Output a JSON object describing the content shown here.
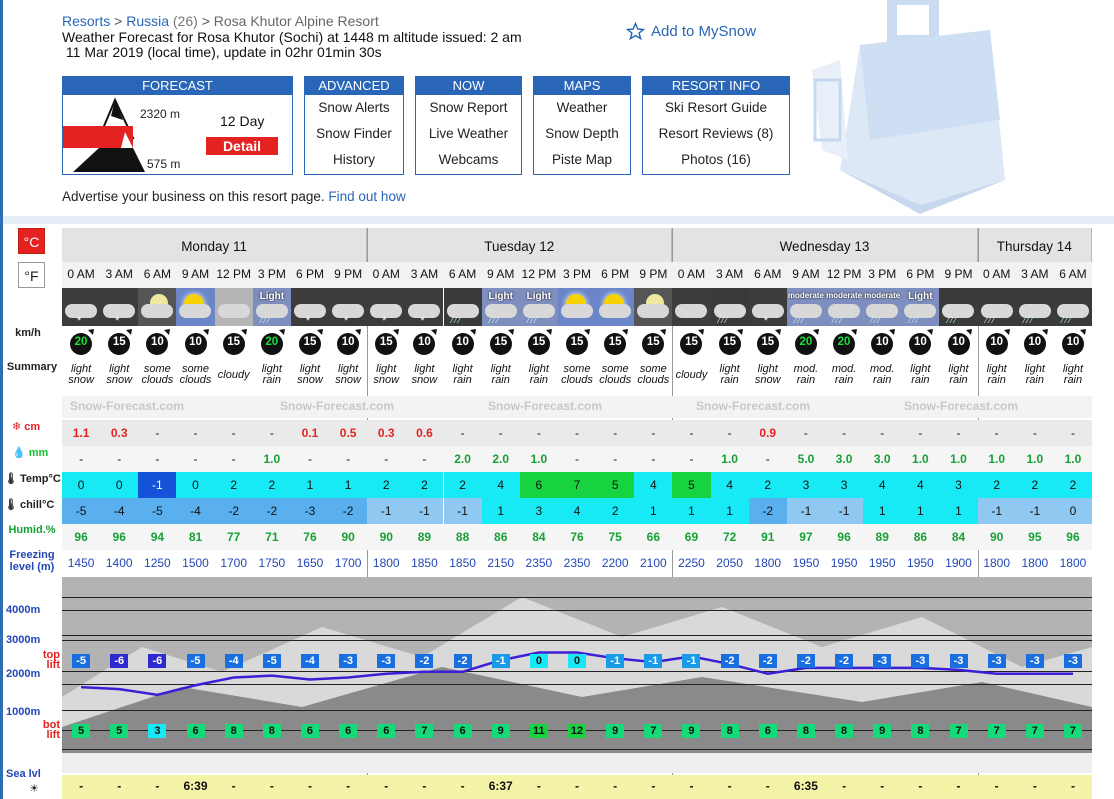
{
  "breadcrumb": {
    "resorts": "Resorts",
    "sep1": ">",
    "russia": "Russia",
    "russia_count": "(26)",
    "sep2": ">",
    "resort": "Rosa Khutor Alpine Resort"
  },
  "heading": {
    "line1": "Weather Forecast for Rosa Khutor (Sochi) at 1448 m altitude issued: 2 am",
    "line2": " 11 Mar 2019 (local time), update in 02hr 01min 30s"
  },
  "mysnow": "Add to MySnow",
  "nav": {
    "forecast": {
      "title": "FORECAST",
      "top": "2320 m",
      "mid": "1448 m",
      "bot": "575 m",
      "days": "12 Day",
      "detail": "Detail"
    },
    "advanced": {
      "title": "ADVANCED",
      "items": [
        "Snow Alerts",
        "Snow Finder",
        "History"
      ]
    },
    "now": {
      "title": "NOW",
      "items": [
        "Snow Report",
        "Live Weather",
        "Webcams"
      ]
    },
    "maps": {
      "title": "MAPS",
      "items": [
        "Weather",
        "Snow Depth",
        "Piste Map"
      ]
    },
    "resort_info": {
      "title": "RESORT INFO",
      "items": [
        "Ski Resort Guide",
        "Resort Reviews (8)",
        "Photos (16)"
      ]
    }
  },
  "advertise": {
    "text": "Advertise your business on this resort page.",
    "link": "Find out how"
  },
  "units": {
    "c": "°C",
    "f": "°F"
  },
  "row_labels": {
    "wind": "km/h",
    "summary": "Summary",
    "snow": "cm",
    "rain": "mm",
    "temp": "Temp°C",
    "chill": "chill°C",
    "humid": "Humid.%",
    "freezing": "Freezing level (m)",
    "top": "top lift",
    "bot": "bot lift",
    "sea": "Sea lvl",
    "l4000": "4000m",
    "l3000": "3000m",
    "l2000": "2000m",
    "l1000": "1000m"
  },
  "days": [
    {
      "name": "Monday 11",
      "cols": 8
    },
    {
      "name": "Tuesday 12",
      "cols": 8
    },
    {
      "name": "Wednesday 13",
      "cols": 8
    },
    {
      "name": "Thursday 14",
      "cols": 3
    }
  ],
  "watermark": "Snow-Forecast.com",
  "colors": {
    "blue": "#2966b8",
    "red": "#e32221",
    "cyan": "#17e8f5",
    "green": "#12d53d"
  },
  "cols": [
    {
      "h": "0 AM",
      "sky": "snow-night",
      "label": "",
      "wind": "20",
      "wc": "green",
      "s1": "light",
      "s2": "snow",
      "snow": "1.1",
      "rain": "-",
      "temp": "0",
      "chill": "-5",
      "hum": "96",
      "frz": "1450",
      "top": "-5",
      "bot": "5"
    },
    {
      "h": "3 AM",
      "sky": "snow-night",
      "label": "",
      "wind": "15",
      "wc": "black",
      "s1": "light",
      "s2": "snow",
      "snow": "0.3",
      "rain": "-",
      "temp": "0",
      "chill": "-4",
      "hum": "96",
      "frz": "1400",
      "top": "-6",
      "bot": "5"
    },
    {
      "h": "6 AM",
      "sky": "moon-cloud",
      "label": "",
      "wind": "10",
      "wc": "black",
      "s1": "some",
      "s2": "clouds",
      "snow": "-",
      "rain": "-",
      "temp": "-1",
      "chill": "-5",
      "hum": "94",
      "frz": "1250",
      "top": "-6",
      "bot": "3"
    },
    {
      "h": "9 AM",
      "sky": "sun-cloud",
      "label": "",
      "wind": "10",
      "wc": "black",
      "s1": "some",
      "s2": "clouds",
      "snow": "-",
      "rain": "-",
      "temp": "0",
      "chill": "-4",
      "hum": "81",
      "frz": "1500",
      "top": "-5",
      "bot": "6"
    },
    {
      "h": "12 PM",
      "sky": "cloudy",
      "label": "",
      "wind": "15",
      "wc": "black",
      "s1": "cloudy",
      "s2": "",
      "snow": "-",
      "rain": "-",
      "temp": "2",
      "chill": "-2",
      "hum": "77",
      "frz": "1700",
      "top": "-4",
      "bot": "8"
    },
    {
      "h": "3 PM",
      "sky": "rain",
      "label": "Light",
      "wind": "20",
      "wc": "green",
      "s1": "light",
      "s2": "rain",
      "snow": "-",
      "rain": "1.0",
      "temp": "2",
      "chill": "-2",
      "hum": "71",
      "frz": "1750",
      "top": "-5",
      "bot": "8"
    },
    {
      "h": "6 PM",
      "sky": "snow-night",
      "label": "",
      "wind": "15",
      "wc": "black",
      "s1": "light",
      "s2": "snow",
      "snow": "0.1",
      "rain": "-",
      "temp": "1",
      "chill": "-3",
      "hum": "76",
      "frz": "1650",
      "top": "-4",
      "bot": "6"
    },
    {
      "h": "9 PM",
      "sky": "snow-night",
      "label": "",
      "wind": "10",
      "wc": "black",
      "s1": "light",
      "s2": "snow",
      "snow": "0.5",
      "rain": "-",
      "temp": "1",
      "chill": "-2",
      "hum": "90",
      "frz": "1700",
      "top": "-3",
      "bot": "6"
    },
    {
      "h": "0 AM",
      "sky": "snow-night",
      "label": "",
      "wind": "15",
      "wc": "black",
      "s1": "light",
      "s2": "snow",
      "snow": "0.3",
      "rain": "-",
      "temp": "2",
      "chill": "-1",
      "hum": "90",
      "frz": "1800",
      "top": "-3",
      "bot": "6"
    },
    {
      "h": "3 AM",
      "sky": "snow-night",
      "label": "",
      "wind": "10",
      "wc": "black",
      "s1": "light",
      "s2": "snow",
      "snow": "0.6",
      "rain": "-",
      "temp": "2",
      "chill": "-1",
      "hum": "89",
      "frz": "1850",
      "top": "-2",
      "bot": "7"
    },
    {
      "h": "6 AM",
      "sky": "rain-night",
      "label": "",
      "wind": "10",
      "wc": "black",
      "s1": "light",
      "s2": "rain",
      "snow": "-",
      "rain": "2.0",
      "temp": "2",
      "chill": "-1",
      "hum": "88",
      "frz": "1850",
      "top": "-2",
      "bot": "6"
    },
    {
      "h": "9 AM",
      "sky": "rain",
      "label": "Light",
      "wind": "15",
      "wc": "black",
      "s1": "light",
      "s2": "rain",
      "snow": "-",
      "rain": "2.0",
      "temp": "4",
      "chill": "1",
      "hum": "86",
      "frz": "2150",
      "top": "-1",
      "bot": "9"
    },
    {
      "h": "12 PM",
      "sky": "rain",
      "label": "Light",
      "wind": "15",
      "wc": "black",
      "s1": "light",
      "s2": "rain",
      "snow": "-",
      "rain": "1.0",
      "temp": "6",
      "chill": "3",
      "hum": "84",
      "frz": "2350",
      "top": "0",
      "bot": "11"
    },
    {
      "h": "3 PM",
      "sky": "sun-cloud",
      "label": "",
      "wind": "15",
      "wc": "black",
      "s1": "some",
      "s2": "clouds",
      "snow": "-",
      "rain": "-",
      "temp": "7",
      "chill": "4",
      "hum": "76",
      "frz": "2350",
      "top": "0",
      "bot": "12"
    },
    {
      "h": "6 PM",
      "sky": "sun-cloud",
      "label": "",
      "wind": "15",
      "wc": "black",
      "s1": "some",
      "s2": "clouds",
      "snow": "-",
      "rain": "-",
      "temp": "5",
      "chill": "2",
      "hum": "75",
      "frz": "2200",
      "top": "-1",
      "bot": "9"
    },
    {
      "h": "9 PM",
      "sky": "moon-cloud",
      "label": "",
      "wind": "15",
      "wc": "black",
      "s1": "some",
      "s2": "clouds",
      "snow": "-",
      "rain": "-",
      "temp": "4",
      "chill": "1",
      "hum": "66",
      "frz": "2100",
      "top": "-1",
      "bot": "7"
    },
    {
      "h": "0 AM",
      "sky": "cloudy-night",
      "label": "",
      "wind": "15",
      "wc": "black",
      "s1": "cloudy",
      "s2": "",
      "snow": "-",
      "rain": "-",
      "temp": "5",
      "chill": "1",
      "hum": "69",
      "frz": "2250",
      "top": "-1",
      "bot": "9"
    },
    {
      "h": "3 AM",
      "sky": "rain-night",
      "label": "",
      "wind": "15",
      "wc": "black",
      "s1": "light",
      "s2": "rain",
      "snow": "-",
      "rain": "1.0",
      "temp": "4",
      "chill": "1",
      "hum": "72",
      "frz": "2050",
      "top": "-2",
      "bot": "8"
    },
    {
      "h": "6 AM",
      "sky": "snow-night",
      "label": "",
      "wind": "15",
      "wc": "black",
      "s1": "light",
      "s2": "snow",
      "snow": "0.9",
      "rain": "-",
      "temp": "2",
      "chill": "-2",
      "hum": "91",
      "frz": "1800",
      "top": "-2",
      "bot": "6"
    },
    {
      "h": "9 AM",
      "sky": "rain",
      "label": "moderate",
      "wind": "20",
      "wc": "green",
      "s1": "mod.",
      "s2": "rain",
      "snow": "-",
      "rain": "5.0",
      "temp": "3",
      "chill": "-1",
      "hum": "97",
      "frz": "1950",
      "top": "-2",
      "bot": "8"
    },
    {
      "h": "12 PM",
      "sky": "rain",
      "label": "moderate",
      "wind": "20",
      "wc": "green",
      "s1": "mod.",
      "s2": "rain",
      "snow": "-",
      "rain": "3.0",
      "temp": "3",
      "chill": "-1",
      "hum": "96",
      "frz": "1950",
      "top": "-2",
      "bot": "8"
    },
    {
      "h": "3 PM",
      "sky": "rain",
      "label": "moderate",
      "wind": "10",
      "wc": "black",
      "s1": "mod.",
      "s2": "rain",
      "snow": "-",
      "rain": "3.0",
      "temp": "4",
      "chill": "1",
      "hum": "89",
      "frz": "1950",
      "top": "-3",
      "bot": "9"
    },
    {
      "h": "6 PM",
      "sky": "rain",
      "label": "Light",
      "wind": "10",
      "wc": "black",
      "s1": "light",
      "s2": "rain",
      "snow": "-",
      "rain": "1.0",
      "temp": "4",
      "chill": "1",
      "hum": "86",
      "frz": "1950",
      "top": "-3",
      "bot": "8"
    },
    {
      "h": "9 PM",
      "sky": "rain-night",
      "label": "",
      "wind": "10",
      "wc": "black",
      "s1": "light",
      "s2": "rain",
      "snow": "-",
      "rain": "1.0",
      "temp": "3",
      "chill": "1",
      "hum": "84",
      "frz": "1900",
      "top": "-3",
      "bot": "7"
    },
    {
      "h": "0 AM",
      "sky": "rain-night",
      "label": "",
      "wind": "10",
      "wc": "black",
      "s1": "light",
      "s2": "rain",
      "snow": "-",
      "rain": "1.0",
      "temp": "2",
      "chill": "-1",
      "hum": "90",
      "frz": "1800",
      "top": "-3",
      "bot": "7"
    },
    {
      "h": "3 AM",
      "sky": "rain-night",
      "label": "",
      "wind": "10",
      "wc": "black",
      "s1": "light",
      "s2": "rain",
      "snow": "-",
      "rain": "1.0",
      "temp": "2",
      "chill": "-1",
      "hum": "95",
      "frz": "1800",
      "top": "-3",
      "bot": "7"
    },
    {
      "h": "6 AM",
      "sky": "rain-night",
      "label": "",
      "wind": "10",
      "wc": "black",
      "s1": "light",
      "s2": "rain",
      "snow": "-",
      "rain": "1.0",
      "temp": "2",
      "chill": "0",
      "hum": "96",
      "frz": "1800",
      "top": "-3",
      "bot": "7"
    }
  ],
  "sunrise": [
    {
      "col": 3,
      "t": "6:39"
    },
    {
      "col": 11,
      "t": "6:37"
    },
    {
      "col": 19,
      "t": "6:35"
    }
  ]
}
